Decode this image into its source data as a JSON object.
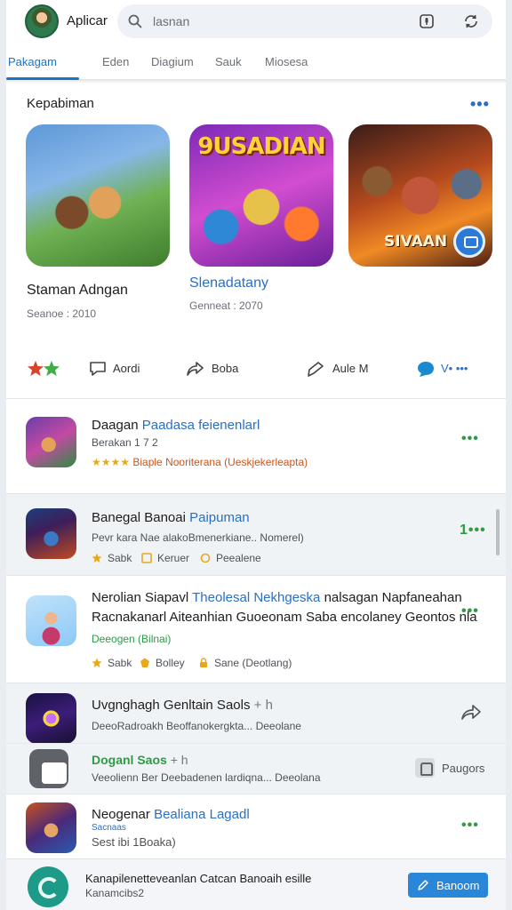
{
  "header": {
    "app_name": "Aplicar",
    "search_placeholder": "lasnan",
    "icons": [
      "avatar",
      "search-icon",
      "mic-icon",
      "sync-icon"
    ]
  },
  "tabs": [
    {
      "label": "Pakagam",
      "active": true
    },
    {
      "label": "Eden",
      "active": false
    },
    {
      "label": "Diagium",
      "active": false
    },
    {
      "label": "Sauk",
      "active": false
    },
    {
      "label": "Miosesa",
      "active": false
    }
  ],
  "featured": {
    "title": "Kepabiman",
    "more": "•••",
    "cards": [
      {
        "logo": "",
        "title": "Staman Adngan",
        "meta": "Seanoe : 2010"
      },
      {
        "logo": "9USADIAN",
        "title": "Slenadatany",
        "meta": "Genneat : 2070"
      },
      {
        "logo": "SIVAAN",
        "title": "",
        "meta": ""
      }
    ]
  },
  "actions": [
    {
      "icon": "rating-icon",
      "label": ""
    },
    {
      "icon": "comment-icon",
      "label": "Aordi"
    },
    {
      "icon": "share-icon",
      "label": "Boba"
    },
    {
      "icon": "send-icon",
      "label": "Aule M"
    },
    {
      "icon": "chat-icon",
      "label": "V• •••"
    }
  ],
  "list": [
    {
      "title_pre": "Daagan",
      "title_hl": "Paadasa feienenlarl",
      "sub": "Berakan 1 7 2",
      "stars": "★★★★",
      "tags_text": "Biaple Nooriterana (Ueskjekerleapta)",
      "more": "•••"
    },
    {
      "title_pre": "Banegal Banoai",
      "title_hl": "Paipuman",
      "sub": "Pevr kara Nae alakoBmenerkiane.. Nomerel)",
      "tags": [
        "Sabk",
        "Keruer",
        "Peealene"
      ],
      "more": "1•••"
    },
    {
      "title_pre": "Nerolian Siapavl",
      "title_hl": "Theolesal Nekhgeska",
      "title_post": "nalsagan Napfaneahan",
      "title_line2": "Racnakanarl Aiteanhian Guoeonam Saba encolaney Geontos nla",
      "sub": "Deeogen (Bilnai)",
      "tags": [
        "Sabk",
        "Bolley",
        "Sane (Deotlang)"
      ],
      "more": "•••"
    },
    {
      "title": "Uvgnghagh Genltain Saols",
      "title_tag": "+ h",
      "sub": "DeeoRadroakh Beoffanokergkta... Deeolane"
    },
    {
      "title": "Doganl Saos",
      "title_tag": "+ h",
      "sub": "Veeolienn Ber Deebadenen lardiqna... Deeolana",
      "pill": "Paugors"
    },
    {
      "title_pre": "Neogenar",
      "title_hl": "Bealiana Lagadl",
      "sub_hl": "Sacnaas",
      "sub": "Sest ibi 1Boaka)",
      "more": "•••"
    }
  ],
  "bottom_bar": {
    "title": "Kanapilenetteveanlan Catcan Banoaih esille",
    "sub": "Kanamcibs2",
    "button": "Banoom"
  },
  "colors": {
    "accent": "#1a73c8",
    "button": "#2a86d8",
    "green_dots": "#2e9a46",
    "band": "#f0f3f6"
  }
}
